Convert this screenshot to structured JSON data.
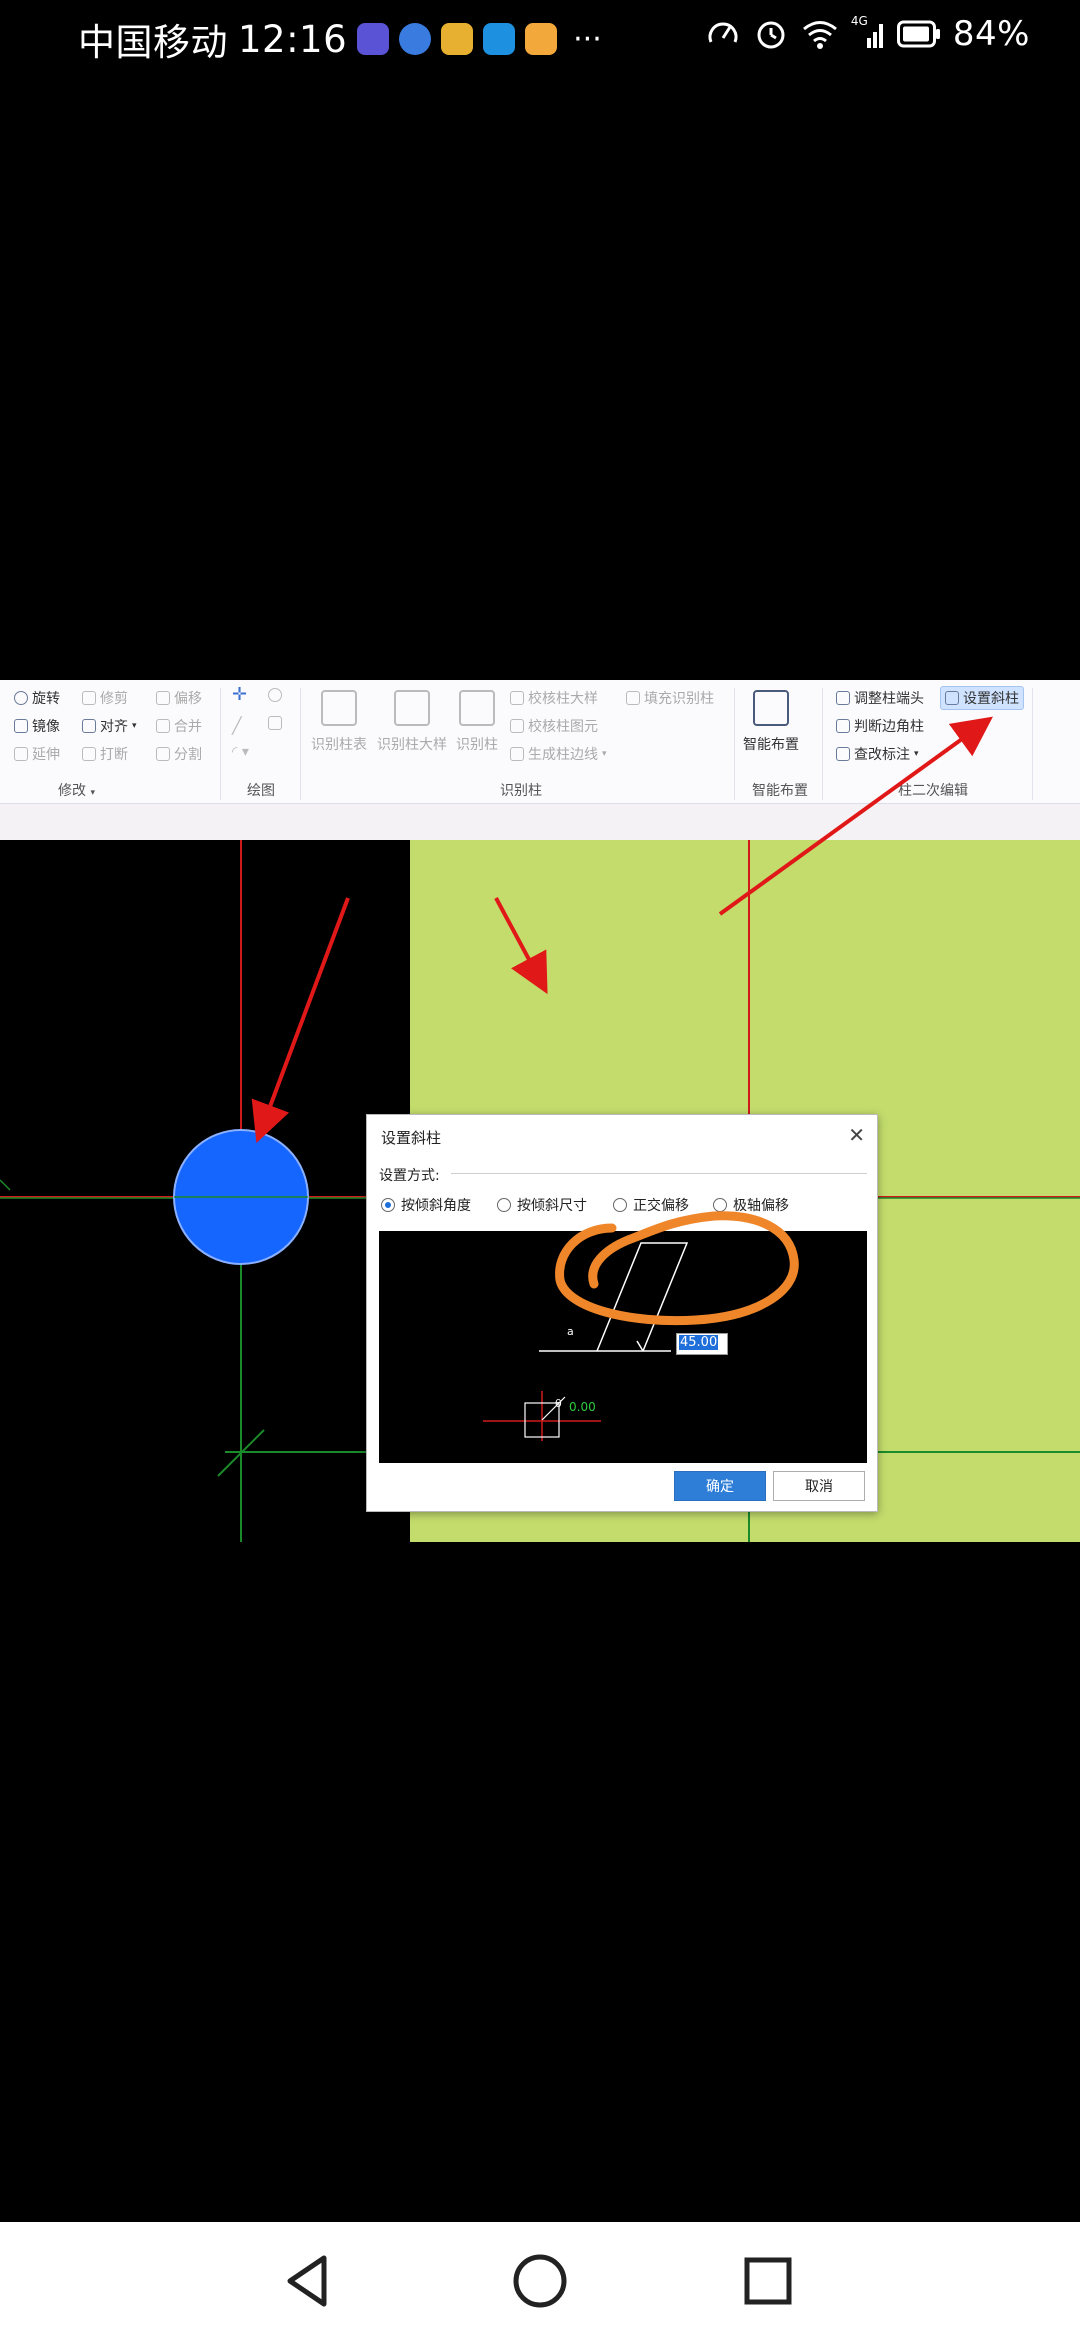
{
  "status_bar": {
    "carrier": "中国移动",
    "time": "12:16",
    "more": "···",
    "network": "4G",
    "battery": "84%",
    "app_icons": [
      {
        "name": "tieba-app-icon",
        "color": "#5b53d6"
      },
      {
        "name": "browser-app-icon",
        "color": "#3a7be0"
      },
      {
        "name": "weibo-app-icon",
        "color": "#e8b030"
      },
      {
        "name": "search-app-icon",
        "color": "#1e90e0"
      },
      {
        "name": "notes-app-icon",
        "color": "#f2a83a"
      }
    ]
  },
  "ribbon": {
    "modify_items": [
      {
        "icon": "rotate-icon",
        "label": "旋转",
        "enabled": true
      },
      {
        "icon": "trim-icon",
        "label": "修剪",
        "enabled": false
      },
      {
        "icon": "offset-icon",
        "label": "偏移",
        "enabled": false
      },
      {
        "icon": "mirror-icon",
        "label": "镜像",
        "enabled": true
      },
      {
        "icon": "align-icon",
        "label": "对齐",
        "enabled": true
      },
      {
        "icon": "merge-icon",
        "label": "合并",
        "enabled": false
      },
      {
        "icon": "extend-icon",
        "label": "延伸",
        "enabled": false
      },
      {
        "icon": "break-icon",
        "label": "打断",
        "enabled": false
      },
      {
        "icon": "split-icon",
        "label": "分割",
        "enabled": false
      }
    ],
    "modify_group": "修改",
    "draw_group": "绘图",
    "identify": {
      "big": [
        "识别柱表",
        "识别柱大样",
        "识别柱"
      ],
      "small": [
        "校核柱大样",
        "填充识别柱",
        "校核柱图元",
        "生成柱边线"
      ],
      "group": "识别柱"
    },
    "smart": {
      "label": "智能布置",
      "group": "智能布置"
    },
    "secondary": {
      "items": [
        "调整柱端头",
        "设置斜柱",
        "判断边角柱",
        "查改标注"
      ],
      "group": "柱二次编辑"
    }
  },
  "dialog": {
    "title": "设置斜柱",
    "section_label": "设置方式:",
    "options": [
      {
        "label": "按倾斜角度",
        "selected": true
      },
      {
        "label": "按倾斜尺寸",
        "selected": false
      },
      {
        "label": "正交偏移",
        "selected": false
      },
      {
        "label": "极轴偏移",
        "selected": false
      }
    ],
    "preview": {
      "angle_a_label": "a",
      "angle_value": "45.00",
      "theta_label": "θ",
      "theta_value": "0.00"
    },
    "ok_label": "确定",
    "cancel_label": "取消"
  },
  "colors": {
    "canvas_bg": "#000000",
    "canvas_green_area": "#c3dc6c",
    "column_circle": "#1565ff",
    "axis_red": "#d01a1a",
    "axis_green": "#1a8a2a",
    "annotation_arrow": "#e01818",
    "annotation_scribble": "#f0862a",
    "dialog_ok": "#2e7ed8"
  }
}
